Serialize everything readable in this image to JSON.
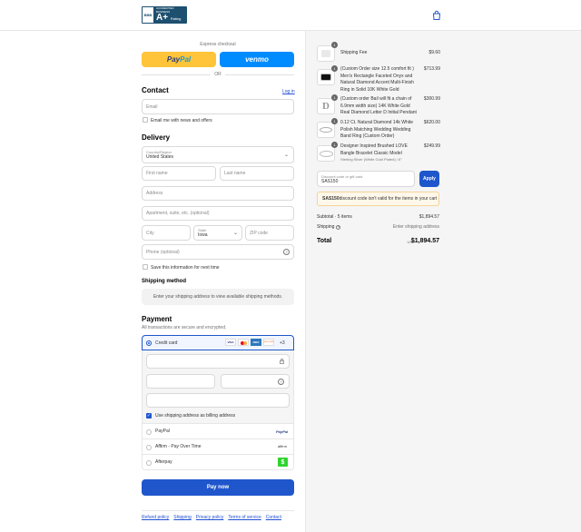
{
  "header": {
    "badge_line1": "ACCREDITED BUSINESS",
    "badge_rating": "A+",
    "badge_rating_word": "Rating",
    "badge_seal": "BBB"
  },
  "express": {
    "label": "Express checkout",
    "paypal_a": "Pay",
    "paypal_b": "Pal",
    "venmo": "venmo",
    "or": "OR"
  },
  "contact": {
    "title": "Contact",
    "login": "Log in",
    "email_placeholder": "Email",
    "news_label": "Email me with news and offers"
  },
  "delivery": {
    "title": "Delivery",
    "country_label": "Country/Region",
    "country_value": "United States",
    "first": "First name",
    "last": "Last name",
    "address": "Address",
    "apt": "Apartment, suite, etc. (optional)",
    "city": "City",
    "state_label": "State",
    "state_value": "Iowa",
    "zip": "ZIP code",
    "phone": "Phone (optional)",
    "save_label": "Save this information for next time"
  },
  "shipping_method": {
    "title": "Shipping method",
    "notice": "Enter your shipping address to view available shipping methods."
  },
  "payment": {
    "title": "Payment",
    "subtitle": "All transactions are secure and encrypted.",
    "credit_card": "Credit card",
    "more": "+3",
    "card_brands": [
      "VISA",
      "MC",
      "AMEX",
      "DISCOVER"
    ],
    "billing_label": "Use shipping address as billing address",
    "options": [
      "PayPal",
      "Affirm - Pay Over Time",
      "Afterpay"
    ],
    "paypal_logo": "PayPal",
    "affirm_logo": "affirm",
    "afterpay_logo": "$"
  },
  "pay_button": "Pay now",
  "footer_links": [
    "Refund policy",
    "Shipping",
    "Privacy policy",
    "Terms of service",
    "Contact"
  ],
  "order": {
    "items": [
      {
        "qty": "1",
        "name": "Shipping Fee",
        "variant": "",
        "price": "$9.60"
      },
      {
        "qty": "1",
        "name": "(Custom Order size 12.5 comfort fit ) Men's Rectangle Faceted Onyx and Natural Diamond Accent Multi-Finish Ring in Solid 10K White Gold",
        "variant": "",
        "price": "$713.99"
      },
      {
        "qty": "1",
        "name": "(Custom order Bail will fit a chain of 6.9mm width size) 14K White Gold Real Diamond Letter D Initial Pendant",
        "variant": "",
        "price": "$300.99"
      },
      {
        "qty": "1",
        "name": "0.12 Ct. Natural Diamond 14k White Polish Matching Wedding Wedding Band Ring (Custom Order)",
        "variant": "",
        "price": "$620.00"
      },
      {
        "qty": "1",
        "name": "Designer Inspired Brushed LOVE Bangle Bracelet Classic Model",
        "variant": "Sterling Silver (White Gold Plated) / 6\"",
        "price": "$249.99"
      }
    ],
    "discount_label": "Discount code or gift card",
    "discount_value": "SAS150",
    "apply": "Apply",
    "error_code": "SAS150",
    "error_text": " discount code isn't valid for the items in your cart",
    "subtotal_label": "Subtotal · 5 items",
    "subtotal": "$1,894.57",
    "shipping_label": "Shipping",
    "shipping_value": "Enter shipping address",
    "total_label": "Total",
    "currency": "USD",
    "total": "$1,894.57"
  },
  "colors": {
    "paypal": "#ffc439",
    "venmo": "#008cff",
    "primary": "#1f56cc",
    "link": "#1f4fd4",
    "error_bg": "#fff8ea",
    "error_border": "#f3d39a"
  }
}
